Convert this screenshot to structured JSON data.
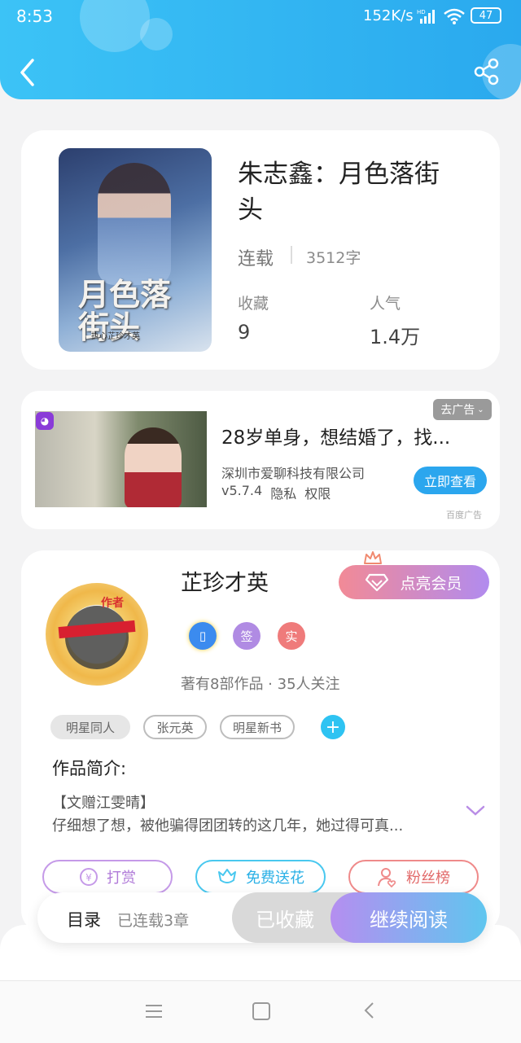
{
  "status_bar": {
    "time": "8:53",
    "speed": "152K/s",
    "battery": "47"
  },
  "book": {
    "title": "朱志鑫：月色落街头",
    "status": "连载",
    "words": "3512字",
    "fav_label": "收藏",
    "fav_value": "9",
    "pop_label": "人气",
    "pop_value": "1.4万",
    "cover_text": "月色落街头",
    "cover_sub": "执心芷珍才英"
  },
  "ad": {
    "close_label": "去广告",
    "title": "28岁单身，想结婚了，找...",
    "company": "深圳市爱聊科技有限公司",
    "version": "v5.7.4",
    "privacy": "隐私",
    "permission": "权限",
    "cta": "立即查看",
    "source": "百度广告"
  },
  "author": {
    "name": "芷珍才英",
    "vip_label": "点亮会员",
    "badges": [
      "签",
      "实"
    ],
    "stats": "著有8部作品 · 35人关注",
    "avatar_text": "作者",
    "tags": [
      "明星同人",
      "张元英",
      "明星新书"
    ]
  },
  "intro": {
    "heading": "作品简介:",
    "line1": "【文赠江雯晴】",
    "line2": "仔细想了想，被他骗得团团转的这几年，她过得可真..."
  },
  "actions": {
    "reward": "打赏",
    "flower": "免费送花",
    "fans": "粉丝榜"
  },
  "bottom_bar": {
    "toc": "目录",
    "chapters": "已连载3章",
    "collected": "已收藏",
    "continue": "继续阅读"
  },
  "colors": {
    "accent": "#2aa9ee",
    "pink": "#ef6b7a",
    "purple": "#a58ef0"
  }
}
